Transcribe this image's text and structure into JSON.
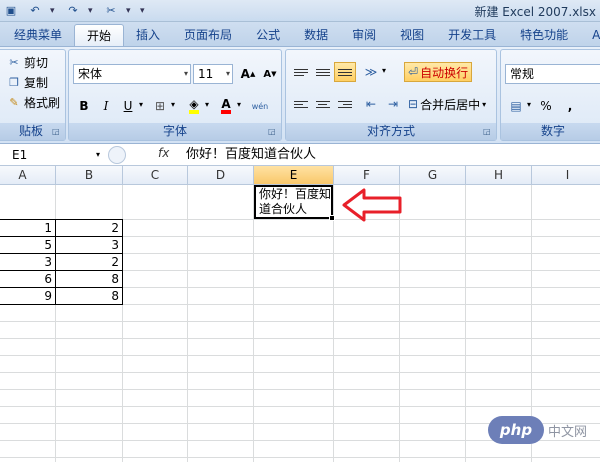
{
  "window": {
    "title": "新建 Excel 2007.xlsx"
  },
  "quick_access": [
    {
      "name": "save-icon",
      "glyph": "▣"
    },
    {
      "name": "undo-icon",
      "glyph": "↶"
    },
    {
      "name": "redo-icon",
      "glyph": "↷"
    },
    {
      "name": "tools-icon",
      "glyph": "✂"
    }
  ],
  "tabs": [
    "经典菜单",
    "开始",
    "插入",
    "页面布局",
    "公式",
    "数据",
    "审阅",
    "视图",
    "开发工具",
    "特色功能",
    "A"
  ],
  "ribbon": {
    "clipboard": {
      "label": "贴板",
      "cut": "剪切",
      "copy": "复制",
      "format_painter": "格式刷"
    },
    "font": {
      "label": "字体",
      "font_name": "宋体",
      "font_size": "11",
      "grow": "A",
      "shrink": "A",
      "bold": "B",
      "italic": "I",
      "underline": "U",
      "fill_color": "#ffff00",
      "font_color": "#ff0000",
      "font_color_glyph": "A",
      "phonetic": "wén"
    },
    "alignment": {
      "label": "对齐方式",
      "wrap_text": "自动换行",
      "merge_center": "合并后居中"
    },
    "number": {
      "label": "数字",
      "format": "常规",
      "percent": "%",
      "comma": ","
    }
  },
  "formula_bar": {
    "name_box": "E1",
    "fx": "fx",
    "content": "你好！百度知道合伙人"
  },
  "columns": [
    "A",
    "B",
    "C",
    "D",
    "E",
    "F",
    "G",
    "H",
    "I"
  ],
  "selected_column": "E",
  "rows": [
    {
      "a": "1",
      "b": "2"
    },
    {
      "a": "5",
      "b": "3"
    },
    {
      "a": "3",
      "b": "2"
    },
    {
      "a": "6",
      "b": "8"
    },
    {
      "a": "9",
      "b": "8"
    }
  ],
  "active_cell": {
    "address": "E1",
    "text": "你好！百度知道合伙人"
  },
  "annotation_arrow_color": "#e8202a",
  "watermark": {
    "badge": "php",
    "text": "中文网"
  }
}
